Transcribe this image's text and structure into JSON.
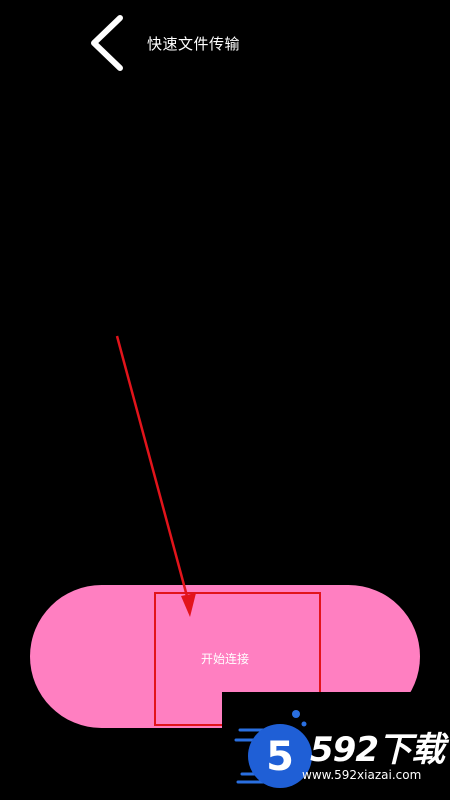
{
  "header": {
    "title": "快速文件传输",
    "back_icon": "chevron-left-icon"
  },
  "main": {
    "connect_button_label": "开始连接"
  },
  "annotation": {
    "color": "#e2141b"
  },
  "colors": {
    "background": "#000000",
    "button_pink": "#ff7fc1",
    "annotation_red": "#e2141b"
  },
  "watermark": {
    "brand": "592下载",
    "url": "www.592xiazai.com",
    "logo_text": "5"
  }
}
